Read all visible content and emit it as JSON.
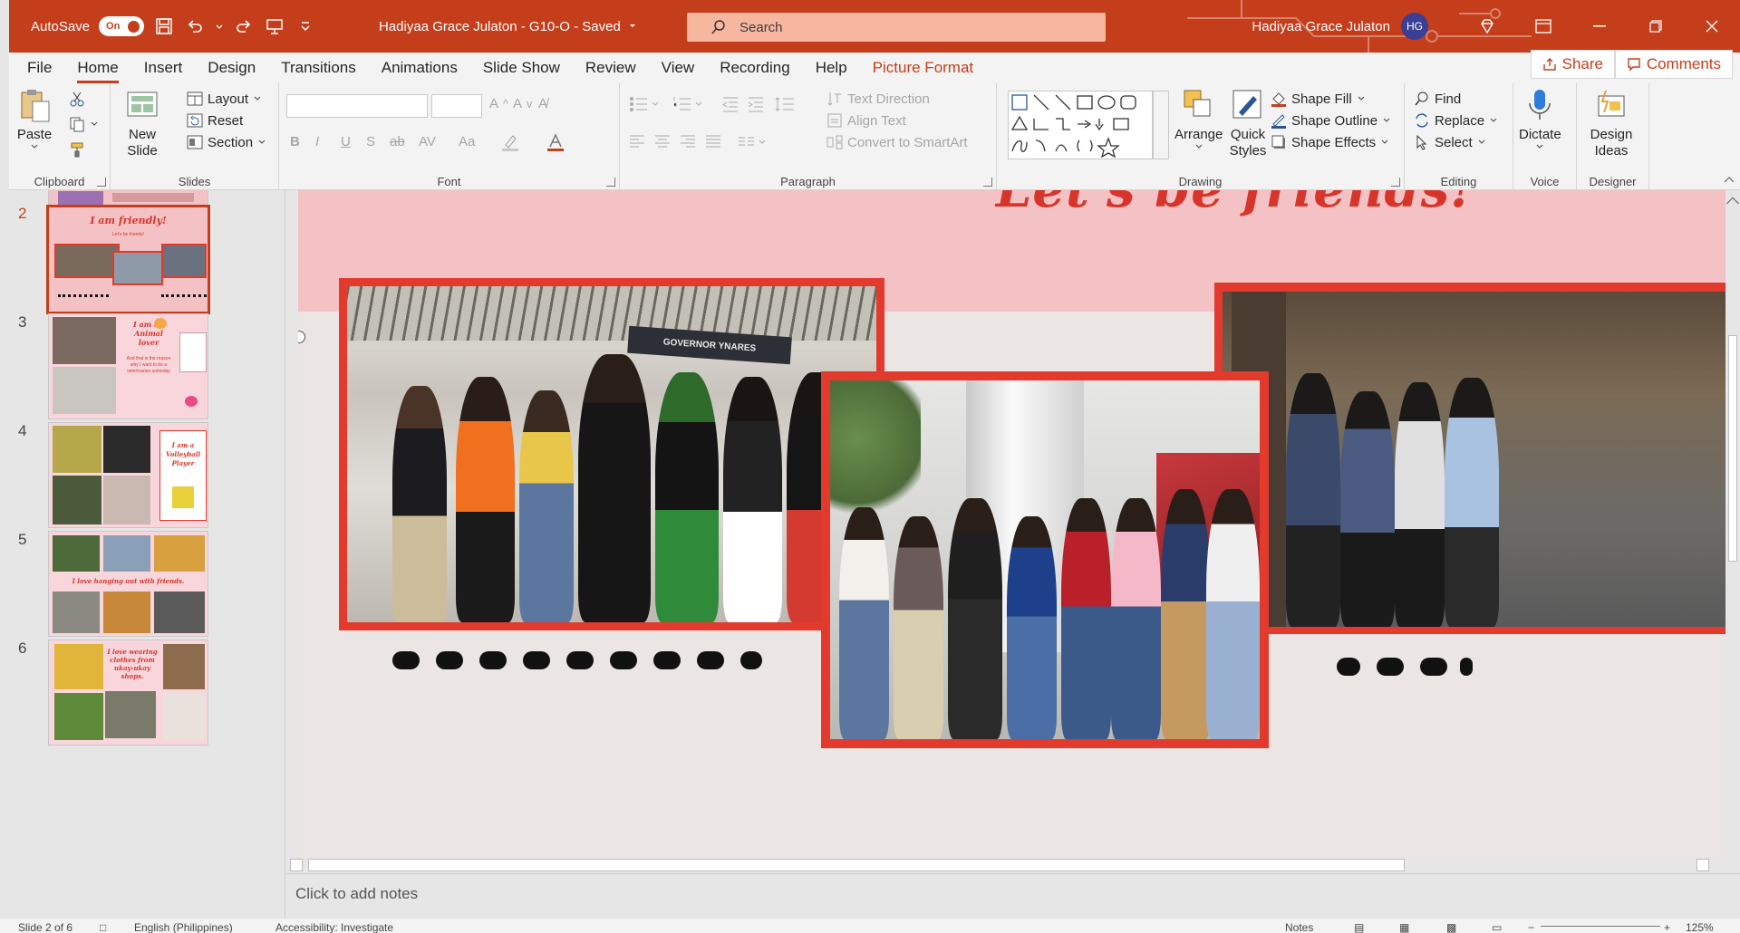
{
  "titlebar": {
    "autosave_label": "AutoSave",
    "autosave_state": "On",
    "doc_title": "Hadiyaa Grace Julaton - G10-O - Saved",
    "search_placeholder": "Search",
    "user_name": "Hadiyaa Grace Julaton",
    "user_initials": "HG"
  },
  "tabs": [
    "File",
    "Home",
    "Insert",
    "Design",
    "Transitions",
    "Animations",
    "Slide Show",
    "Review",
    "View",
    "Recording",
    "Help",
    "Picture Format"
  ],
  "share_label": "Share",
  "comments_label": "Comments",
  "ribbon": {
    "clipboard": {
      "paste": "Paste",
      "label": "Clipboard"
    },
    "slides": {
      "new_slide": "New Slide",
      "layout": "Layout",
      "reset": "Reset",
      "section": "Section",
      "label": "Slides"
    },
    "font": {
      "label": "Font",
      "buttons": [
        "B",
        "I",
        "U",
        "S",
        "ab",
        "AV",
        "Aa"
      ]
    },
    "paragraph": {
      "text_direction": "Text Direction",
      "align_text": "Align Text",
      "convert_smartart": "Convert to SmartArt",
      "label": "Paragraph"
    },
    "drawing": {
      "arrange": "Arrange",
      "quick_styles": "Quick Styles",
      "shape_fill": "Shape Fill",
      "shape_outline": "Shape Outline",
      "shape_effects": "Shape Effects",
      "label": "Drawing"
    },
    "editing": {
      "find": "Find",
      "replace": "Replace",
      "select": "Select",
      "label": "Editing"
    },
    "voice": {
      "dictate": "Dictate",
      "label": "Voice"
    },
    "designer": {
      "design_ideas": "Design Ideas",
      "label": "Designer"
    }
  },
  "thumbnails": [
    {
      "num": "2",
      "title": "I am friendly!",
      "subtitle": "Let's be friends!"
    },
    {
      "num": "3",
      "title": "I am an Animal lover",
      "subtitle": "And that is the reason why I want to be a veterinarian someday"
    },
    {
      "num": "4",
      "title": "I am a Volleyball Player"
    },
    {
      "num": "5",
      "title": "I love hanging out with friends."
    },
    {
      "num": "6",
      "title": "I love wearing clothes from ukay-ukay shops."
    }
  ],
  "slide": {
    "title_fragment": "Let's be friends!",
    "banner_text": "GOVERNOR YNARES"
  },
  "notes_placeholder": "Click to add notes",
  "status": {
    "slide_count": "Slide 2 of 6",
    "language": "English (Philippines)",
    "accessibility": "Accessibility: Investigate",
    "notes": "Notes",
    "zoom": "125%"
  },
  "colors": {
    "brand": "#c43e1c",
    "frame_red": "#e23a2c",
    "slide_pink": "#f4c2c4"
  }
}
